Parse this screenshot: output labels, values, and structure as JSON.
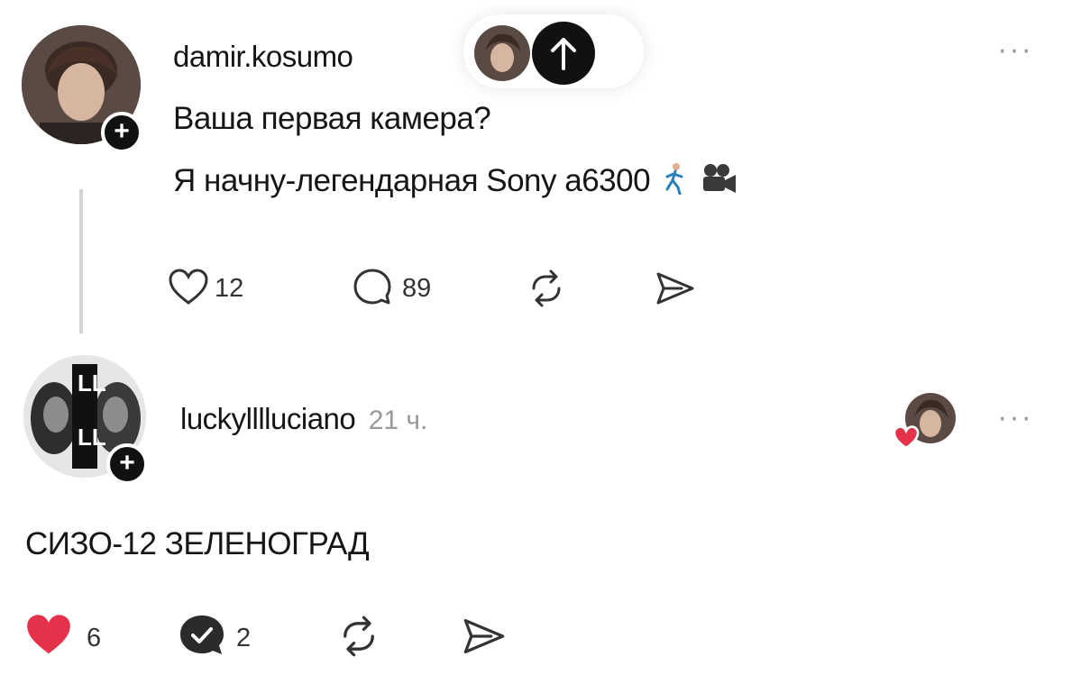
{
  "post": {
    "username": "damir.kosumo",
    "question": "Ваша первая камера?",
    "answer": "Я начну-легендарная Sony a6300",
    "likes": "12",
    "comments": "89",
    "liked": false
  },
  "reply": {
    "username": "luckylllluciano",
    "time": "21 ч.",
    "avatar_text_top": "LL",
    "avatar_text_bottom": "LL",
    "text": "СИЗО-12 ЗЕЛЕНОГРАД",
    "likes": "6",
    "comments": "2",
    "liked": true
  },
  "icons": {
    "add": "plus-icon",
    "more": "more-horizontal-icon",
    "like": "heart-icon",
    "comment": "comment-bubble-icon",
    "repost": "repost-arrows-icon",
    "share": "share-send-icon",
    "scroll_up": "arrow-up-icon"
  },
  "colors": {
    "like_active": "#e5324a",
    "muted": "#9a9a9a"
  }
}
